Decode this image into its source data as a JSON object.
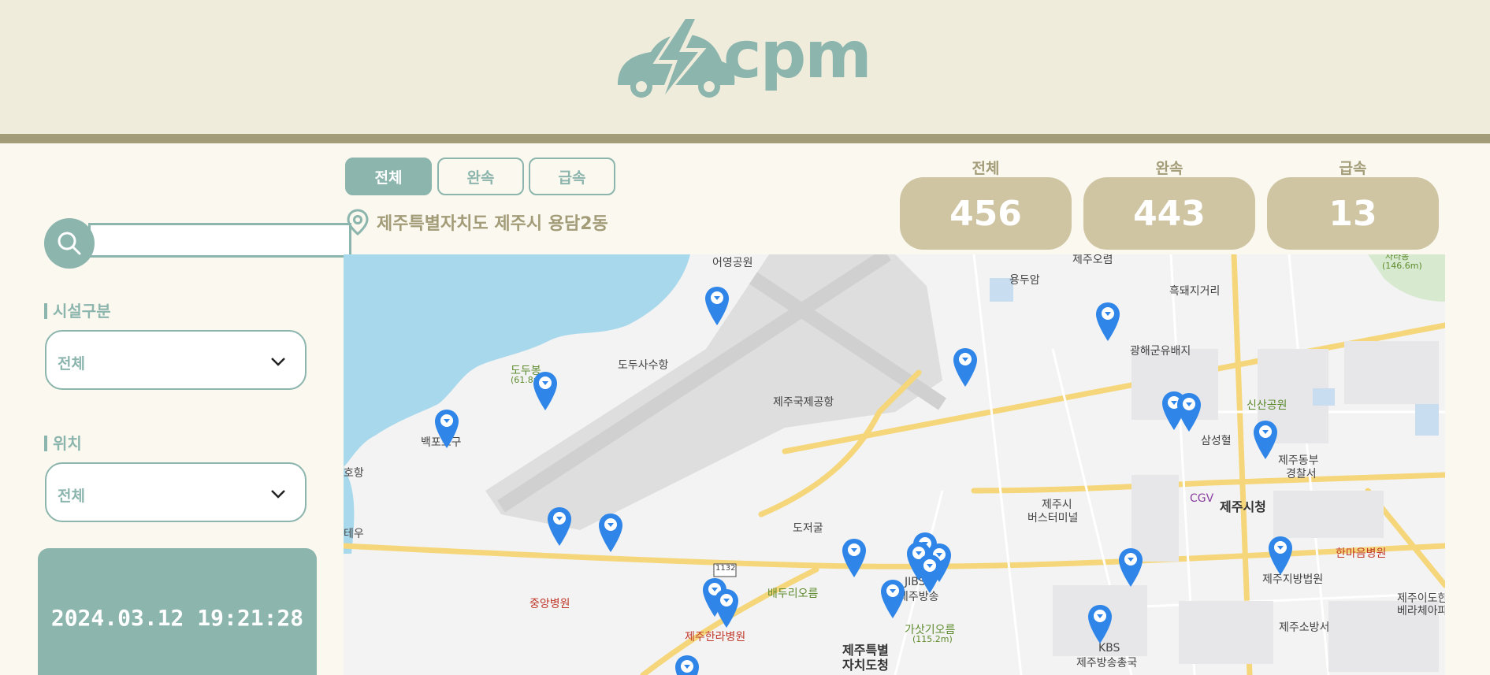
{
  "brand": {
    "name": "cpm",
    "accent": "#8bb5ad",
    "beige": "#a39c78",
    "box": "#cfc5a3"
  },
  "sidebar": {
    "search": {
      "value": "",
      "placeholder": ""
    },
    "facility": {
      "label": "시설구분",
      "selected": "전체"
    },
    "region": {
      "label": "위치",
      "selected": "전체"
    },
    "clock": "2024.03.12  19:21:28"
  },
  "tabs": [
    {
      "label": "전체",
      "active": true
    },
    {
      "label": "완속",
      "active": false
    },
    {
      "label": "급속",
      "active": false
    }
  ],
  "location": "제주특별자치도 제주시 용담2동",
  "stats": [
    {
      "label": "전체",
      "value": "456"
    },
    {
      "label": "완속",
      "value": "443"
    },
    {
      "label": "급속",
      "value": "13"
    }
  ],
  "map": {
    "labels": {
      "l1": "어영공원",
      "l2": "용두암",
      "l3": "제주오렴",
      "l4": "흑돼지거리",
      "l5": "도두봉",
      "l6": "(61.8m)",
      "l7": "도두사수항",
      "l8": "제주국제공항",
      "l9": "광해군유배지",
      "l10": "신산공원",
      "l11": "삼성혈",
      "l12": "백포포구",
      "l13": "호항",
      "l14": "제주동부",
      "l15": "경찰서",
      "l16": "CGV",
      "l17": "제주시청",
      "l18": "제주시",
      "l19": "버스터미널",
      "l20": "도저굴",
      "l21": "테우",
      "l22": "한마음병원",
      "l23": "1132",
      "l24": "중앙병원",
      "l25": "배두리오름",
      "l26": "JIBS",
      "l27": "제주방송",
      "l28": "제주지방법원",
      "l29": "제주이도한",
      "l30": "베라체아파",
      "l31": "제주한라병원",
      "l32": "가삿기오름",
      "l33": "(115.2m)",
      "l34": "제주소방서",
      "l35": "제주특별",
      "l36": "자치도청",
      "l37": "KBS",
      "l38": "제주방송총국",
      "l39": "사라봉",
      "l40": "(146.6m)"
    }
  }
}
